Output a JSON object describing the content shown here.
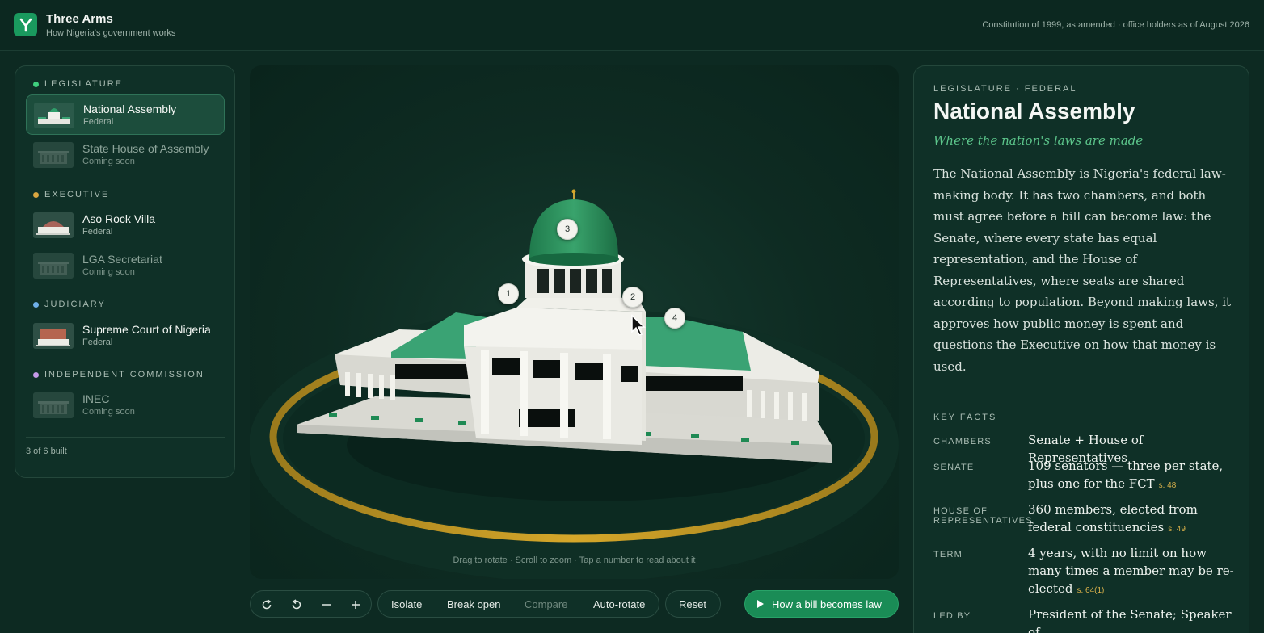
{
  "app": {
    "title": "Three Arms",
    "subtitle": "How Nigeria's government works",
    "meta": "Constitution of 1999, as amended · office holders as of August 2026",
    "colors": {
      "accent": "#1a9a5e",
      "background": "#0d2a22",
      "cite": "#d8b04a"
    }
  },
  "sidebar": {
    "groups": [
      {
        "label": "LEGISLATURE",
        "dot_color": "#3fcf7e",
        "items": [
          {
            "name": "National Assembly",
            "sub": "Federal",
            "active": true
          },
          {
            "name": "State House of Assembly",
            "sub": "Coming soon",
            "active": false
          }
        ]
      },
      {
        "label": "EXECUTIVE",
        "dot_color": "#d9a640",
        "items": [
          {
            "name": "Aso Rock Villa",
            "sub": "Federal",
            "active": false
          },
          {
            "name": "LGA Secretariat",
            "sub": "Coming soon",
            "active": false
          }
        ]
      },
      {
        "label": "JUDICIARY",
        "dot_color": "#6fb0e8",
        "items": [
          {
            "name": "Supreme Court of Nigeria",
            "sub": "Federal",
            "active": false
          }
        ]
      },
      {
        "label": "INDEPENDENT COMMISSION",
        "dot_color": "#c49ae8",
        "items": [
          {
            "name": "INEC",
            "sub": "Coming soon",
            "active": false
          }
        ]
      }
    ],
    "built_count": "3 of 6 built"
  },
  "viewer": {
    "hint": "Drag to rotate · Scroll to zoom · Tap a number to read about it",
    "hotspots": [
      "1",
      "2",
      "3",
      "4"
    ]
  },
  "toolbar": {
    "icons": [
      "rotate-cw-icon",
      "rotate-ccw-icon",
      "zoom-out-icon",
      "zoom-in-icon"
    ],
    "modes": [
      "Isolate",
      "Break open",
      "Compare",
      "Auto-rotate"
    ],
    "reset": "Reset",
    "cta": "How a bill becomes law"
  },
  "detail": {
    "eyebrow": "LEGISLATURE · FEDERAL",
    "title": "National Assembly",
    "tagline": "Where the nation's laws are made",
    "body": "The National Assembly is Nigeria's federal law-making body. It has two chambers, and both must agree before a bill can become law: the Senate, where every state has equal representation, and the House of Representatives, where seats are shared according to population. Beyond making laws, it approves how public money is spent and questions the Executive on how that money is used.",
    "facts_label": "KEY FACTS",
    "facts": [
      {
        "key": "CHAMBERS",
        "value": "Senate + House of Representatives",
        "cite": ""
      },
      {
        "key": "SENATE",
        "value": "109 senators — three per state, plus one for the FCT",
        "cite": "s. 48"
      },
      {
        "key": "HOUSE OF REPRESENTATIVES",
        "value": "360 members, elected from federal constituencies",
        "cite": "s. 49"
      },
      {
        "key": "TERM",
        "value": "4 years, with no limit on how many times a member may be re-elected",
        "cite": "s. 64(1)"
      },
      {
        "key": "LED BY",
        "value": "President of the Senate; Speaker of",
        "cite": ""
      }
    ]
  }
}
